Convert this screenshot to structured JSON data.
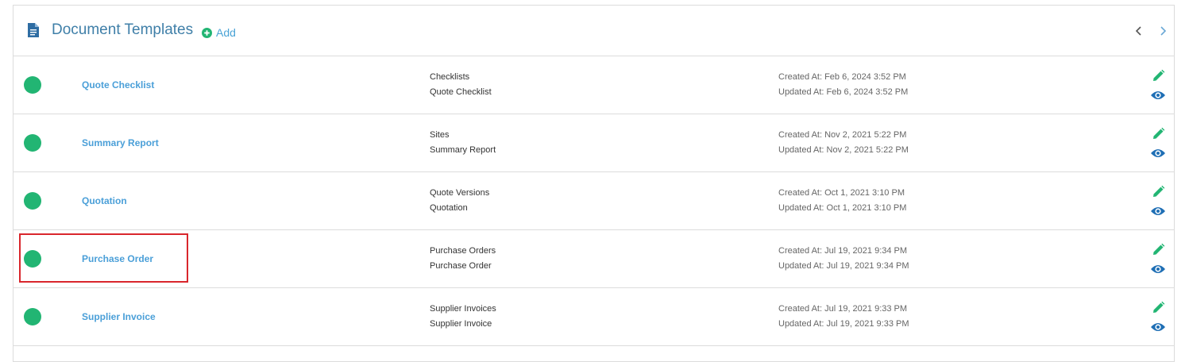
{
  "header": {
    "title": "Document Templates",
    "add_label": "Add",
    "icons": {
      "document": "document-icon",
      "add": "plus-circle-icon",
      "prev": "chevron-left-icon",
      "next": "chevron-right-icon"
    }
  },
  "colors": {
    "status_active": "#22b573",
    "link": "#4a9fd8",
    "title": "#3f7fa8",
    "edit_icon": "#22b573",
    "view_icon": "#1f6fb5",
    "highlight": "#d9262c"
  },
  "templates": [
    {
      "name": "Quote Checklist",
      "category": "Checklists",
      "subcategory": "Quote Checklist",
      "created": "Created At: Feb 6, 2024 3:52 PM",
      "updated": "Updated At: Feb 6, 2024 3:52 PM"
    },
    {
      "name": "Summary Report",
      "category": "Sites",
      "subcategory": "Summary Report",
      "created": "Created At: Nov 2, 2021 5:22 PM",
      "updated": "Updated At: Nov 2, 2021 5:22 PM"
    },
    {
      "name": "Quotation",
      "category": "Quote Versions",
      "subcategory": "Quotation",
      "created": "Created At: Oct 1, 2021 3:10 PM",
      "updated": "Updated At: Oct 1, 2021 3:10 PM"
    },
    {
      "name": "Purchase Order",
      "category": "Purchase Orders",
      "subcategory": "Purchase Order",
      "created": "Created At: Jul 19, 2021 9:34 PM",
      "updated": "Updated At: Jul 19, 2021 9:34 PM"
    },
    {
      "name": "Supplier Invoice",
      "category": "Supplier Invoices",
      "subcategory": "Supplier Invoice",
      "created": "Created At: Jul 19, 2021 9:33 PM",
      "updated": "Updated At: Jul 19, 2021 9:33 PM"
    }
  ]
}
